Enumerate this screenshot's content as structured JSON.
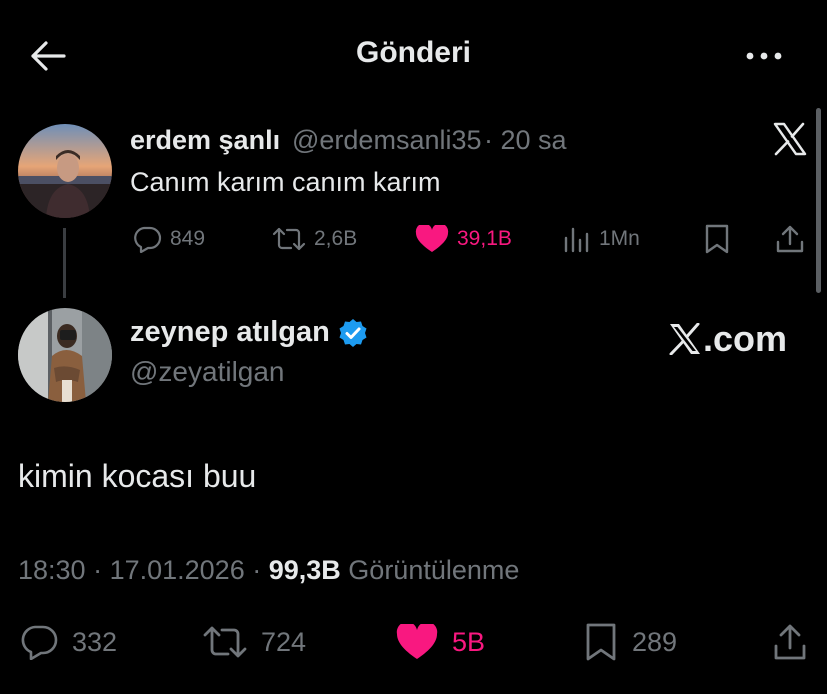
{
  "header": {
    "title": "Gönderi",
    "back_icon": "arrow-left-icon",
    "more_icon": "more-horizontal-icon"
  },
  "quoted_tweet": {
    "display_name": "erdem şanlı",
    "handle": "@erdemsanli35",
    "separator": "·",
    "time": "20 sa",
    "text": "Canım karım canım karım",
    "actions": {
      "replies": "849",
      "reposts": "2,6B",
      "likes": "39,1B",
      "views": "1Mn"
    },
    "like_color": "#f91880"
  },
  "main_tweet": {
    "display_name": "zeynep atılgan",
    "handle": "@zeyatilgan",
    "verified": true,
    "verified_color": "#1d9bf0",
    "watermark": ".com",
    "text": "kimin kocası buu",
    "meta": {
      "time": "18:30",
      "date": "17.01.2026",
      "views_count": "99,3B",
      "views_label": "Görüntülenme"
    },
    "actions": {
      "replies": "332",
      "reposts": "724",
      "likes": "5B",
      "bookmarks": "289"
    }
  },
  "colors": {
    "background": "#000000",
    "text": "#e7e9ea",
    "muted": "#71767b",
    "like": "#f91880"
  }
}
